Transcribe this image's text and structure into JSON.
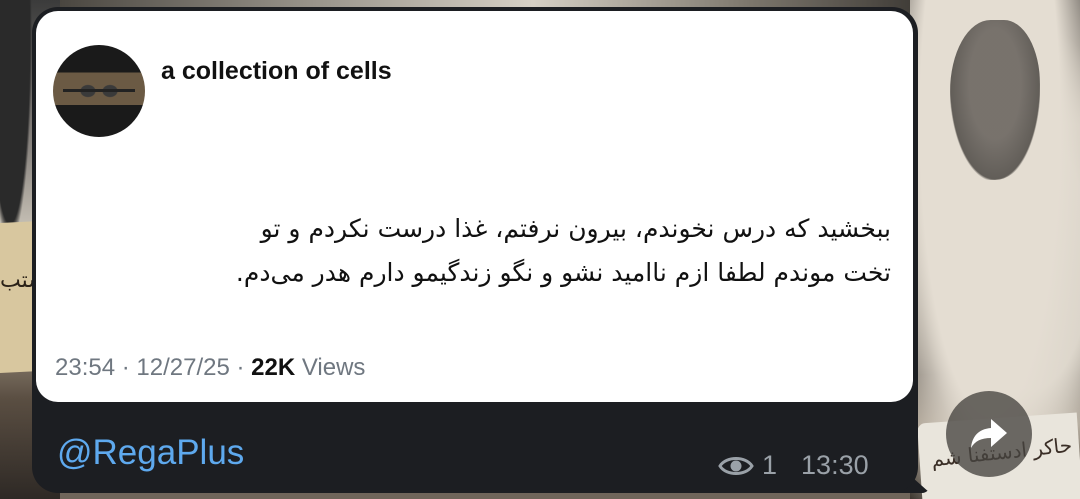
{
  "background_plaque_text": "حاکر ادستفنا شم",
  "background_paper_text": "ستب",
  "tweet": {
    "author_name": "a collection of cells",
    "text": "ببخشید که درس نخوندم، بیرون نرفتم، غذا درست نکردم و تو\nتخت موندم لطفا ازم ناامید نشو و نگو زندگیمو دارم هدر می‌دم.",
    "time": "23:54",
    "date": "12/27/25",
    "separator": " · ",
    "views_count": "22K",
    "views_label": "Views"
  },
  "message": {
    "channel_link": "@RegaPlus",
    "views": "1",
    "time": "13:30"
  },
  "icons": {
    "eye": "eye-icon",
    "forward": "forward-arrow-icon"
  },
  "colors": {
    "bubble": "#1c1e22",
    "link": "#5ea9ee",
    "meta": "#9aa1a8",
    "tweet_meta": "#6f7780"
  }
}
